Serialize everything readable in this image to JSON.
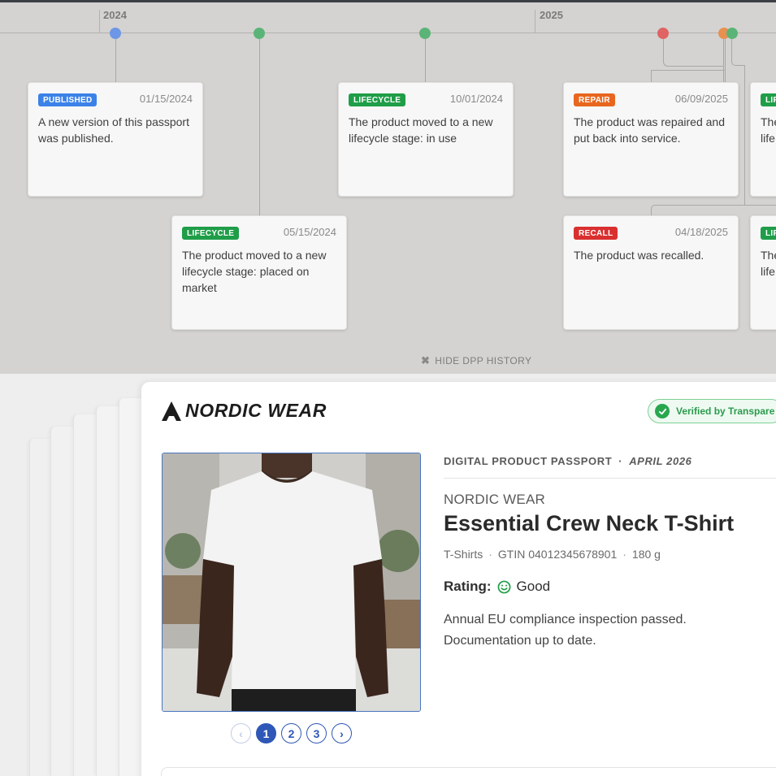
{
  "timeline": {
    "years": [
      "2024",
      "2025"
    ],
    "dot_colors": [
      "#6e96e6",
      "#5bb477",
      "#5bb477",
      "#e06464",
      "#e89050",
      "#5bb477"
    ],
    "events": [
      {
        "badge": "PUBLISHED",
        "badge_color": "#3b82e8",
        "date": "01/15/2024",
        "text": "A new version of this passport was published."
      },
      {
        "badge": "LIFECYCLE",
        "badge_color": "#1f9d48",
        "date": "05/15/2024",
        "text": "The product moved to a new lifecycle stage: placed on market"
      },
      {
        "badge": "LIFECYCLE",
        "badge_color": "#1f9d48",
        "date": "10/01/2024",
        "text": "The product moved to a new lifecycle stage: in use"
      },
      {
        "badge": "REPAIR",
        "badge_color": "#e8661f",
        "date": "06/09/2025",
        "text": "The product was repaired and put back into service."
      },
      {
        "badge": "RECALL",
        "badge_color": "#d92f2f",
        "date": "04/18/2025",
        "text": "The product was recalled."
      },
      {
        "badge": "LIF",
        "badge_color": "#1f9d48",
        "date": "",
        "text": "The life"
      },
      {
        "badge": "LIF",
        "badge_color": "#1f9d48",
        "date": "",
        "text": "The life"
      }
    ],
    "hide_label": "HIDE DPP HISTORY"
  },
  "passport": {
    "logo_text": "NORDIC WEAR",
    "verified_label": "Verified by Transpare",
    "header_label": "DIGITAL PRODUCT PASSPORT",
    "header_sep": "·",
    "header_date": "APRIL 2026",
    "brand": "NORDIC WEAR",
    "product_name": "Essential Crew Neck T-Shirt",
    "category": "T-Shirts",
    "gtin": "GTIN 04012345678901",
    "weight": "180 g",
    "meta_sep": "·",
    "rating_label": "Rating:",
    "rating_value": "Good",
    "description": "Annual EU compliance inspection passed. Documentation up to date.",
    "pages": [
      "1",
      "2",
      "3"
    ],
    "current_page": 1
  }
}
